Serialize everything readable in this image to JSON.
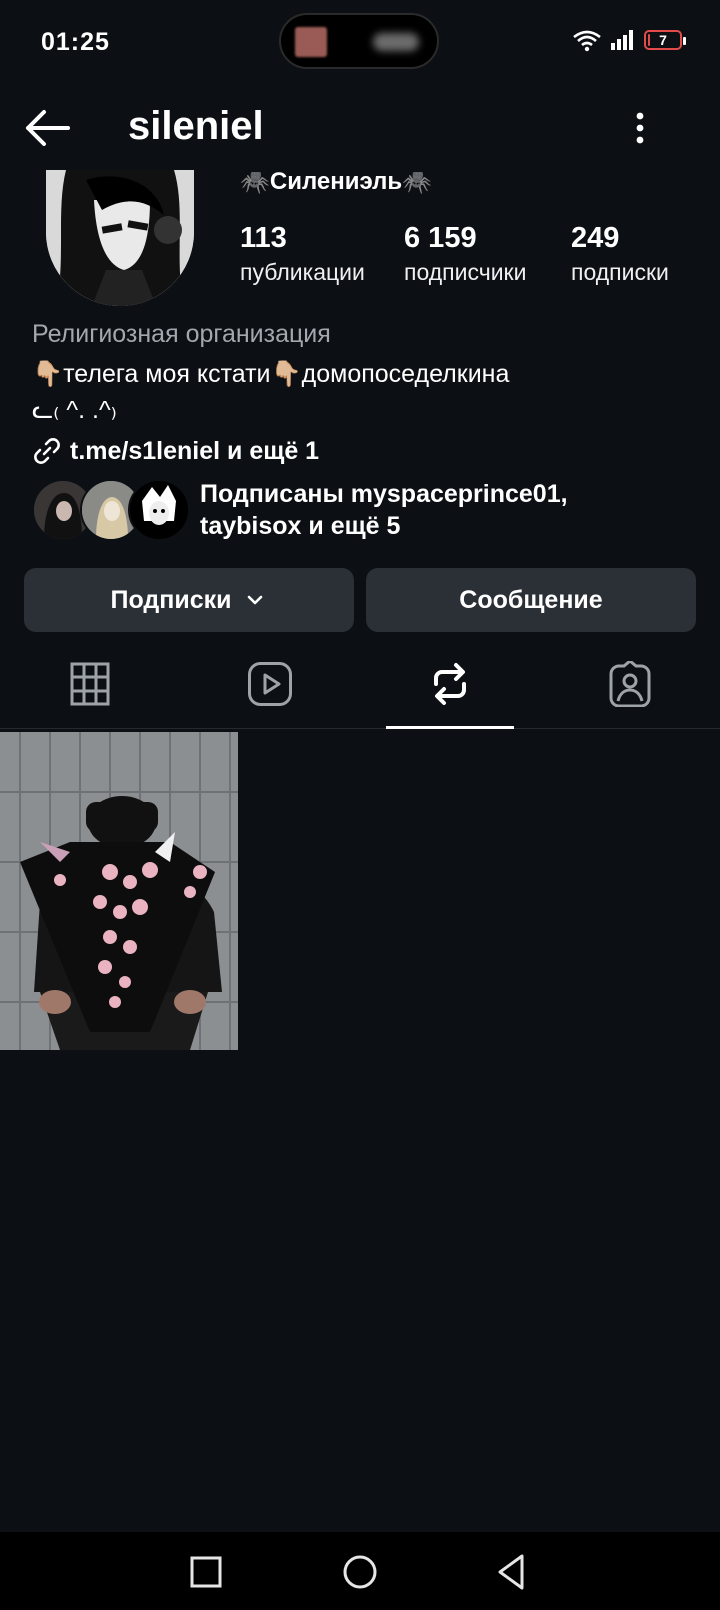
{
  "status_bar": {
    "time": "01:25",
    "battery": "7",
    "battery_level": 0.07
  },
  "header": {
    "username": "sileniel"
  },
  "profile": {
    "display_name": "🕷️Силениэль🕷️",
    "stats": [
      {
        "value": "113",
        "label": "публикации"
      },
      {
        "value": "6 159",
        "label": "подписчики"
      },
      {
        "value": "249",
        "label": "подписки"
      }
    ],
    "category": "Религиозная организация",
    "bio_line1": "👇🏼телега моя кстати👇🏼домопоседелкина",
    "bio_line2": "ᓚ₍ ^. .^₎",
    "link": "t.me/s1leniel и ещё 1",
    "followed_by": "Подписаны myspaceprince01, taybisox и ещё 5"
  },
  "buttons": {
    "following": "Подписки",
    "message": "Сообщение"
  },
  "tabs": [
    "posts-grid",
    "reels",
    "reposts",
    "tagged"
  ],
  "active_tab": "reposts",
  "colors": {
    "background": "#0c1014",
    "button": "#2b3036",
    "secondary_text": "#a3a8ae"
  }
}
